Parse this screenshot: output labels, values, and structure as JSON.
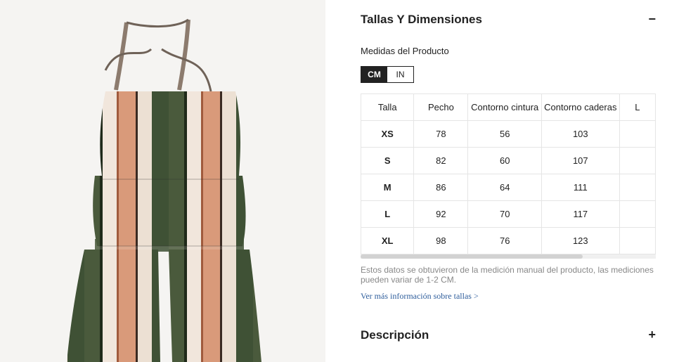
{
  "product_image": {
    "alt": ""
  },
  "sizes_section": {
    "title": "Tallas Y Dimensiones",
    "toggle": "−"
  },
  "subtitle": "Medidas del Producto",
  "units": {
    "cm": "CM",
    "in": "IN",
    "selected": "CM"
  },
  "table": {
    "headers": [
      "Talla",
      "Pecho",
      "Contorno cintura",
      "Contorno caderas",
      "L"
    ],
    "rows": [
      [
        "XS",
        "78",
        "56",
        "103",
        ""
      ],
      [
        "S",
        "82",
        "60",
        "107",
        ""
      ],
      [
        "M",
        "86",
        "64",
        "111",
        ""
      ],
      [
        "L",
        "92",
        "70",
        "117",
        ""
      ],
      [
        "XL",
        "98",
        "76",
        "123",
        ""
      ]
    ]
  },
  "note": "Estos datos se obtuvieron de la medición manual del producto, las mediciones pueden variar de 1-2 CM.",
  "more_link": "Ver más información sobre tallas >",
  "description_section": {
    "title": "Descripción",
    "toggle": "+"
  }
}
